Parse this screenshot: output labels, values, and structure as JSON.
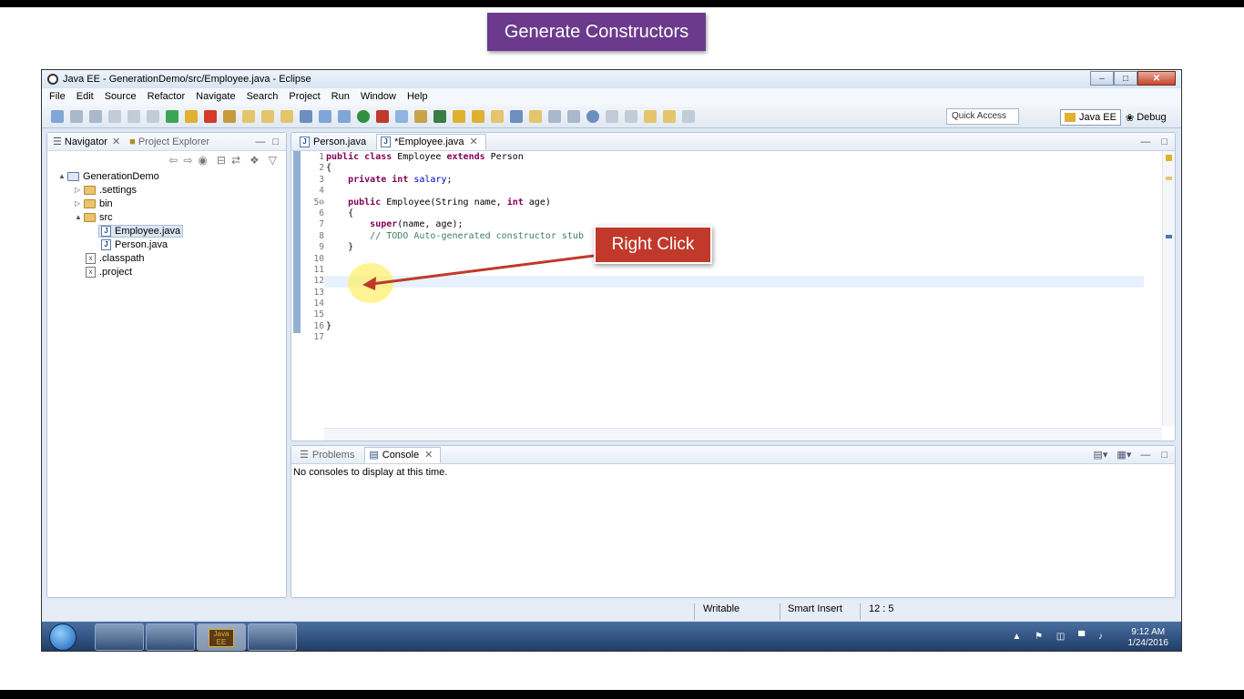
{
  "banner": {
    "title": "Generate Constructors"
  },
  "window": {
    "title": "Java EE - GenerationDemo/src/Employee.java - Eclipse"
  },
  "menu": [
    "File",
    "Edit",
    "Source",
    "Refactor",
    "Navigate",
    "Search",
    "Project",
    "Run",
    "Window",
    "Help"
  ],
  "toolbar": {
    "quick_access": "Quick Access",
    "perspective_active": "Java EE",
    "perspective_other": "Debug"
  },
  "navigator": {
    "tab_active": "Navigator",
    "tab_inactive": "Project Explorer",
    "tree": [
      {
        "label": "GenerationDemo",
        "type": "project",
        "level": 0,
        "expander": "▲"
      },
      {
        "label": ".settings",
        "type": "folder",
        "level": 1,
        "expander": "▷"
      },
      {
        "label": "bin",
        "type": "folder",
        "level": 1,
        "expander": "▷"
      },
      {
        "label": "src",
        "type": "folder",
        "level": 1,
        "expander": "▲"
      },
      {
        "label": "Employee.java",
        "type": "java",
        "level": 2,
        "expander": "",
        "selected": true
      },
      {
        "label": "Person.java",
        "type": "java",
        "level": 2,
        "expander": ""
      },
      {
        "label": ".classpath",
        "type": "xml",
        "level": 1,
        "expander": ""
      },
      {
        "label": ".project",
        "type": "xml",
        "level": 1,
        "expander": ""
      }
    ]
  },
  "editor": {
    "tabs": [
      {
        "label": "Person.java",
        "active": false
      },
      {
        "label": "*Employee.java",
        "active": true
      }
    ],
    "line_numbers": [
      "1",
      "2",
      "3",
      "4",
      "5⊖",
      "6",
      "7",
      "8",
      "9",
      "10",
      "11",
      "12",
      "13",
      "14",
      "15",
      "16",
      "17"
    ],
    "highlight_line": 12
  },
  "console": {
    "tab_inactive": "Problems",
    "tab_active": "Console",
    "message": "No consoles to display at this time."
  },
  "status": {
    "writable": "Writable",
    "insert_mode": "Smart Insert",
    "position": "12 : 5"
  },
  "taskbar": {
    "time": "9:12 AM",
    "date": "1/24/2016",
    "java_ee_label": "Java EE"
  },
  "annotation": {
    "callout": "Right Click"
  },
  "colors": {
    "banner": "#6b3a8c",
    "callout": "#c0392b",
    "keyword": "#7f0055",
    "field": "#0000c0",
    "comment": "#3f7f5f"
  }
}
